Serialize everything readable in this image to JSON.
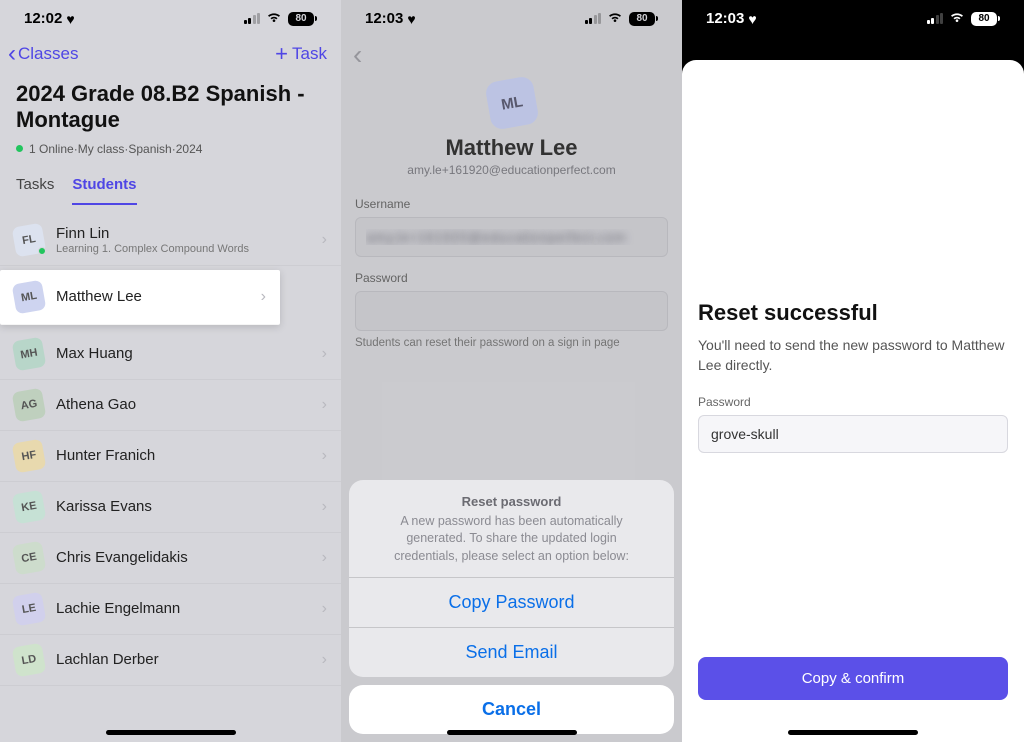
{
  "status": {
    "t1": "12:02",
    "t2": "12:03",
    "t3": "12:03",
    "battery": "80"
  },
  "p1": {
    "back_label": "Classes",
    "add_label": "Task",
    "title": "2024 Grade 08.B2 Spanish - Montague",
    "meta": "1 Online·My class·Spanish·2024",
    "tabs": {
      "tasks": "Tasks",
      "students": "Students"
    },
    "students": [
      {
        "initials": "FL",
        "name": "Finn Lin",
        "sub": "Learning  1. Complex Compound Words",
        "cls": "c-fl",
        "online": true
      },
      {
        "initials": "ML",
        "name": "Matthew Lee",
        "sub": "",
        "cls": "c-ml",
        "highlight": true
      },
      {
        "initials": "MH",
        "name": "Max Huang",
        "sub": "",
        "cls": "c-mh"
      },
      {
        "initials": "AG",
        "name": "Athena Gao",
        "sub": "",
        "cls": "c-ag"
      },
      {
        "initials": "HF",
        "name": "Hunter Franich",
        "sub": "",
        "cls": "c-hf"
      },
      {
        "initials": "KE",
        "name": "Karissa Evans",
        "sub": "",
        "cls": "c-ke"
      },
      {
        "initials": "CE",
        "name": "Chris Evangelidakis",
        "sub": "",
        "cls": "c-ce"
      },
      {
        "initials": "LE",
        "name": "Lachie Engelmann",
        "sub": "",
        "cls": "c-le"
      },
      {
        "initials": "LD",
        "name": "Lachlan Derber",
        "sub": "",
        "cls": "c-ld"
      }
    ]
  },
  "p2": {
    "initials": "ML",
    "name": "Matthew Lee",
    "email": "amy.le+161920@educationperfect.com",
    "username_label": "Username",
    "username_value": "amy.le+161920@educationperfect.com",
    "password_label": "Password",
    "password_hint": "Students can reset their password on a sign in page",
    "sheet": {
      "title": "Reset password",
      "desc": "A new password has been automatically generated. To share the updated login credentials, please select an option below:",
      "copy": "Copy Password",
      "send": "Send Email",
      "cancel": "Cancel"
    }
  },
  "p3": {
    "title": "Reset successful",
    "desc": "You'll need to send the new password to Matthew Lee directly.",
    "label": "Password",
    "value": "grove-skull",
    "button": "Copy & confirm"
  }
}
